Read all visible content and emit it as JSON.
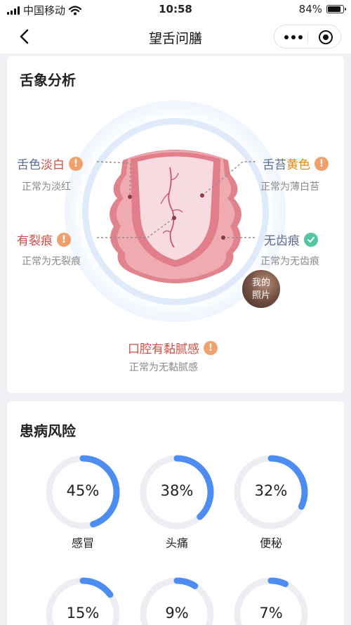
{
  "status_bar": {
    "carrier": "中国移动",
    "time": "10:58",
    "battery": "84%",
    "battery_level": 0.84
  },
  "nav": {
    "title": "望舌问膳"
  },
  "tongue_section": {
    "title": "舌象分析",
    "tongue_color": {
      "prefix": "舌色",
      "value": "淡白",
      "note": "正常为淡红",
      "status": "warning"
    },
    "coating": {
      "prefix": "舌苔",
      "value": "黄色",
      "note": "正常为薄白苔",
      "status": "warning"
    },
    "cracks": {
      "value": "有裂痕",
      "note": "正常为无裂痕",
      "status": "warning"
    },
    "teeth_marks": {
      "value": "无齿痕",
      "note": "正常为无齿痕",
      "status": "ok"
    },
    "mouth": {
      "value": "口腔有黏腻感",
      "note": "正常为无黏腻感",
      "status": "warning"
    },
    "photo_label": "我的照片",
    "colors": {
      "abnormal_red": "#d14d43",
      "abnormal_orange": "#e8860c",
      "normal_slate": "#5a6b8c",
      "warning_icon": "#f0a06a",
      "ok_icon": "#55c4a2"
    }
  },
  "risk_section": {
    "title": "患病风险",
    "accent": "#4d8df2",
    "items": [
      {
        "label": "感冒",
        "percent": 45
      },
      {
        "label": "头痛",
        "percent": 38
      },
      {
        "label": "便秘",
        "percent": 32
      },
      {
        "label": "",
        "percent": 15
      },
      {
        "label": "",
        "percent": 9
      },
      {
        "label": "",
        "percent": 7
      }
    ]
  }
}
